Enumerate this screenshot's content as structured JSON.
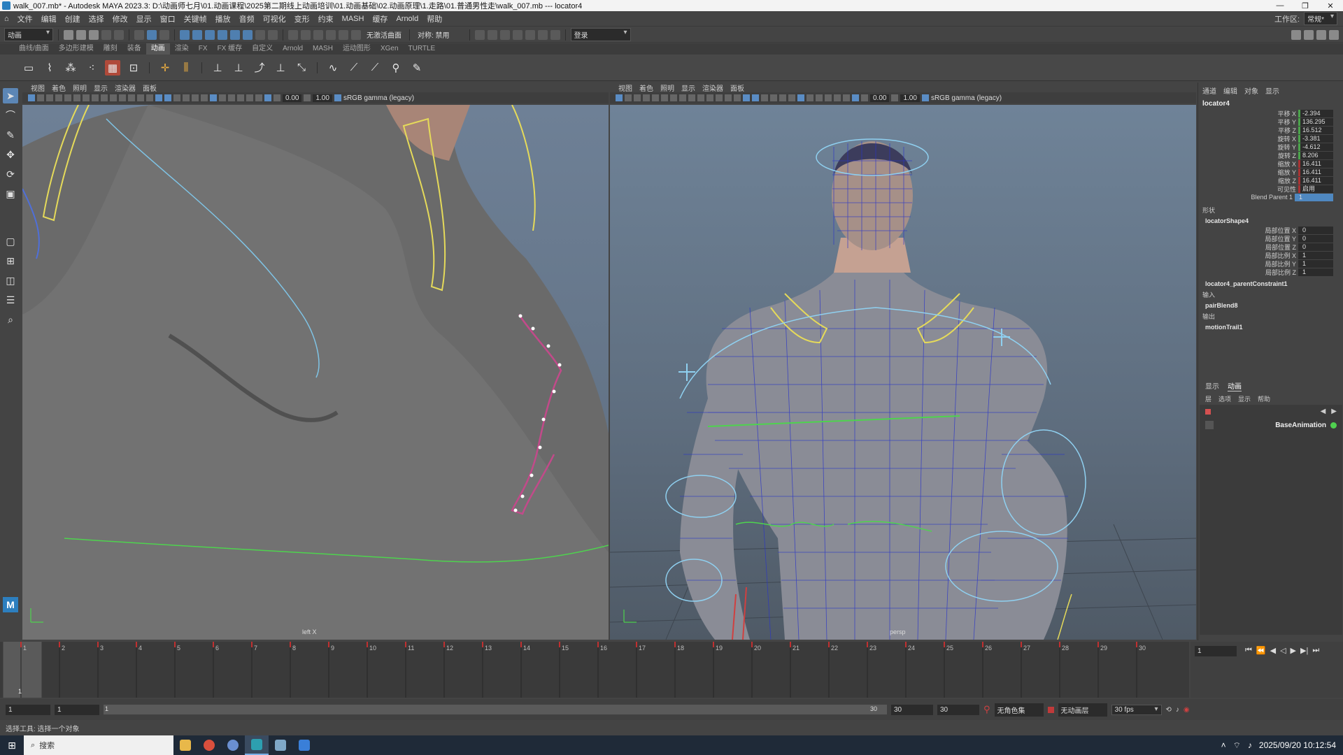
{
  "window": {
    "title": "walk_007.mb* - Autodesk MAYA 2023.3: D:\\动画师七月\\01.动画课程\\2025第二期线上动画培训\\01.动画基础\\02.动画原理\\1.走路\\01.普通男性走\\walk_007.mb  ---  locator4",
    "controls": [
      "—",
      "❐",
      "✕"
    ]
  },
  "menubar": {
    "items": [
      "文件",
      "编辑",
      "创建",
      "选择",
      "修改",
      "显示",
      "窗口",
      "关键帧",
      "播放",
      "音频",
      "可视化",
      "变形",
      "约束",
      "MASH",
      "缓存",
      "Arnold",
      "帮助"
    ],
    "workspace_label": "工作区:",
    "workspace_value": "常规*"
  },
  "statusline": {
    "mode": "动画",
    "live_surface": "无激活曲面",
    "symmetry": "对称: 禁用",
    "login": "登录"
  },
  "shelf": {
    "tabs": [
      "曲线/曲面",
      "多边形建模",
      "雕刻",
      "装备",
      "动画",
      "渲染",
      "FX",
      "FX 缓存",
      "自定义",
      "Arnold",
      "MASH",
      "运动图形",
      "XGen",
      "TURTLE"
    ],
    "active_tab": "动画"
  },
  "viewport_left": {
    "menus": [
      "视图",
      "着色",
      "照明",
      "显示",
      "渲染器",
      "面板"
    ],
    "exposure": "0.00",
    "gamma": "1.00",
    "colorspace": "sRGB gamma (legacy)",
    "camera": "left X"
  },
  "viewport_right": {
    "menus": [
      "视图",
      "着色",
      "照明",
      "显示",
      "渲染器",
      "面板"
    ],
    "exposure": "0.00",
    "gamma": "1.00",
    "colorspace": "sRGB gamma (legacy)",
    "camera": "persp"
  },
  "channelbox": {
    "tabs": [
      "通道",
      "编辑",
      "对象",
      "显示"
    ],
    "object": "locator4",
    "attributes": [
      {
        "label": "平移 X",
        "value": "-2.394"
      },
      {
        "label": "平移 Y",
        "value": "136.295"
      },
      {
        "label": "平移 Z",
        "value": "16.512"
      },
      {
        "label": "旋转 X",
        "value": "-3.381"
      },
      {
        "label": "旋转 Y",
        "value": "-4.612"
      },
      {
        "label": "旋转 Z",
        "value": "8.206"
      },
      {
        "label": "缩放 X",
        "value": "16.411"
      },
      {
        "label": "缩放 Y",
        "value": "16.411"
      },
      {
        "label": "缩放 Z",
        "value": "16.411"
      },
      {
        "label": "可见性",
        "value": "启用"
      },
      {
        "label": "Blend Parent 1",
        "value": "1"
      }
    ],
    "shapes_header": "形状",
    "shape_name": "locatorShape4",
    "shape_attributes": [
      {
        "label": "局部位置 X",
        "value": "0"
      },
      {
        "label": "局部位置 Y",
        "value": "0"
      },
      {
        "label": "局部位置 Z",
        "value": "0"
      },
      {
        "label": "局部比例 X",
        "value": "1"
      },
      {
        "label": "局部比例 Y",
        "value": "1"
      },
      {
        "label": "局部比例 Z",
        "value": "1"
      }
    ],
    "constraint": "locator4_parentConstraint1",
    "inputs_header": "输入",
    "input_node": "pairBlend8",
    "outputs_header": "输出",
    "output_node": "motionTrail1",
    "layer_tabs": [
      "显示",
      "动画"
    ],
    "layer_menus": [
      "层",
      "选项",
      "显示",
      "帮助"
    ],
    "anim_layer": "BaseAnimation"
  },
  "timeline": {
    "ticks": [
      "1",
      "2",
      "3",
      "4",
      "5",
      "6",
      "7",
      "8",
      "9",
      "10",
      "11",
      "12",
      "13",
      "14",
      "15",
      "16",
      "17",
      "18",
      "19",
      "20",
      "21",
      "22",
      "23",
      "24",
      "25",
      "26",
      "27",
      "28",
      "29",
      "30"
    ],
    "current_frame": "1",
    "frame_field": "1"
  },
  "range": {
    "start": "1",
    "start_inner": "1",
    "slider_start": "1",
    "slider_end": "30",
    "end_inner": "30",
    "end": "30",
    "char_set": "无角色集",
    "anim_layer": "无动画层",
    "fps": "30 fps"
  },
  "cmdline": {
    "text": "选择工具: 选择一个对象"
  },
  "taskbar": {
    "search": "搜索",
    "datetime": "2025/09/20 10:12:54"
  }
}
